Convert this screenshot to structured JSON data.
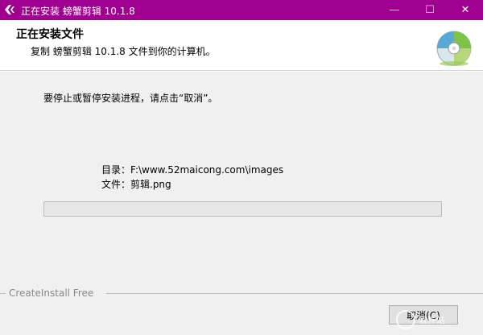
{
  "window": {
    "title": "正在安装 螃蟹剪辑 10.1.8",
    "minimize_glyph": "—",
    "maximize_glyph": "☐",
    "close_glyph": "✕",
    "titlebar_color": "#a0008f"
  },
  "header": {
    "title": "正在安装文件",
    "subtitle": "复制 螃蟹剪辑 10.1.8 文件到你的计算机。",
    "icon": "disc-icon"
  },
  "body": {
    "instruction": "要停止或暂停安装进程，请点击“取消”。",
    "directory_line": "目录：F:\\www.52maicong.com\\images",
    "file_line": "文件：剪辑.png",
    "progress_fraction": 0
  },
  "footer": {
    "brand": "CreateInstall Free",
    "cancel_label": "取消(C)"
  },
  "watermark": {
    "text": "软件站"
  }
}
